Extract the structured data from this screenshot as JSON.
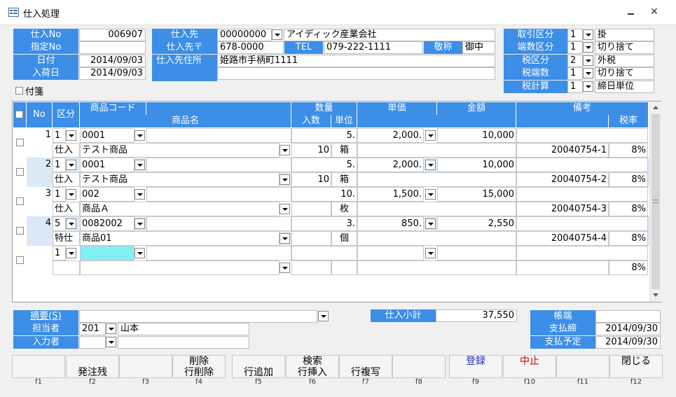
{
  "window": {
    "title": "仕入処理"
  },
  "header": {
    "shiire_no_label": "仕入No",
    "shiire_no": "006907",
    "shitei_no_label": "指定No",
    "shitei_no": "",
    "date_label": "日付",
    "date": "2014/09/03",
    "arrival_label": "入荷日",
    "arrival": "2014/09/03",
    "fusen_label": "付箋",
    "supplier_label": "仕入先",
    "supplier_code": "00000000",
    "supplier_name": "アイディック産業会社",
    "supplier_zip_label": "仕入先〒",
    "supplier_zip": "678-0000",
    "tel_label": "TEL",
    "tel": "079-222-1111",
    "keisho_label": "敬称",
    "keisho": "御中",
    "address_label": "仕入先住所",
    "address": "姫路市手柄町1111",
    "torihiki_label": "取引区分",
    "torihiki_code": "1",
    "torihiki_name": "掛",
    "hasu_label": "端数区分",
    "hasu_code": "1",
    "hasu_name": "切り捨て",
    "zei_label": "税区分",
    "zei_code": "2",
    "zei_name": "外税",
    "zeihasu_label": "税端数",
    "zeihasu_code": "1",
    "zeihasu_name": "切り捨て",
    "zeikeisan_label": "税計算",
    "zeikeisan_code": "1",
    "zeikeisan_name": "締日単位"
  },
  "grid": {
    "columns": {
      "no": "No",
      "kubun": "区分",
      "item_code": "商品コード",
      "item_name": "商品名",
      "qty": "数量",
      "qty_in": "入数",
      "unit": "単位",
      "price": "単価",
      "amount": "金額",
      "remarks": "備考",
      "tax_rate": "税率"
    },
    "rows": [
      {
        "no": "1",
        "kubun_code": "1",
        "kubun_name": "仕入",
        "item_code": "0001",
        "item_name": "テスト商品",
        "qty": "5.",
        "qty_in": "10",
        "unit": "箱",
        "price": "2,000.",
        "amount": "10,000",
        "remarks": "20040754-1",
        "tax_rate": "8%"
      },
      {
        "no": "2",
        "kubun_code": "1",
        "kubun_name": "仕入",
        "item_code": "0001",
        "item_name": "テスト商品",
        "qty": "5.",
        "qty_in": "10",
        "unit": "箱",
        "price": "2,000.",
        "amount": "10,000",
        "remarks": "20040754-2",
        "tax_rate": "8%"
      },
      {
        "no": "3",
        "kubun_code": "1",
        "kubun_name": "仕入",
        "item_code": "002",
        "item_name": "商品Ａ",
        "qty": "10.",
        "qty_in": "",
        "unit": "枚",
        "price": "1,500.",
        "amount": "15,000",
        "remarks": "20040754-3",
        "tax_rate": "8%"
      },
      {
        "no": "4",
        "kubun_code": "5",
        "kubun_name": "特仕",
        "item_code": "0082002",
        "item_name": "商品01",
        "qty": "3.",
        "qty_in": "",
        "unit": "個",
        "price": "850.",
        "amount": "2,550",
        "remarks": "20040754-4",
        "tax_rate": "8%"
      },
      {
        "no": "",
        "kubun_code": "1",
        "kubun_name": "",
        "item_code": "",
        "item_name": "",
        "qty": "",
        "qty_in": "",
        "unit": "",
        "price": "",
        "amount": "",
        "remarks": "",
        "tax_rate": "8%"
      }
    ]
  },
  "footer": {
    "tekiyo_label": "摘要(S)",
    "tekiyo": "",
    "tanto_label": "担当者",
    "tanto_code": "201",
    "tanto_name": "山本",
    "nyuryoku_label": "入力者",
    "nyuryoku_code": "",
    "nyuryoku_name": "",
    "subtotal_label": "仕入小計",
    "subtotal": "37,550",
    "chobata_label": "帳端",
    "chobata": "",
    "shiharai_shime_label": "支払締",
    "shiharai_shime": "2014/09/30",
    "shiharai_yotei_label": "支払予定",
    "shiharai_yotei": "2014/09/30"
  },
  "fkeys": [
    {
      "key": "f1",
      "l1": "",
      "l2": ""
    },
    {
      "key": "f2",
      "l1": "",
      "l2": "発注残"
    },
    {
      "key": "f3",
      "l1": "",
      "l2": ""
    },
    {
      "key": "f4",
      "l1": "削除",
      "l2": "行削除"
    },
    {
      "key": "f5",
      "l1": "",
      "l2": "行追加"
    },
    {
      "key": "f6",
      "l1": "検索",
      "l2": "行挿入"
    },
    {
      "key": "f7",
      "l1": "",
      "l2": "行複写"
    },
    {
      "key": "f8",
      "l1": "",
      "l2": ""
    },
    {
      "key": "f9",
      "l1": "登録",
      "l2": ""
    },
    {
      "key": "f10",
      "l1": "中止",
      "l2": ""
    },
    {
      "key": "f11",
      "l1": "",
      "l2": ""
    },
    {
      "key": "f12",
      "l1": "閉じる",
      "l2": ""
    }
  ],
  "colors": {
    "label_bg": "#3c8ee6",
    "row_alt": "#dbe9f7",
    "highlight": "#7ff0f4",
    "register": "#1f2fbf",
    "cancel": "#c00000"
  }
}
